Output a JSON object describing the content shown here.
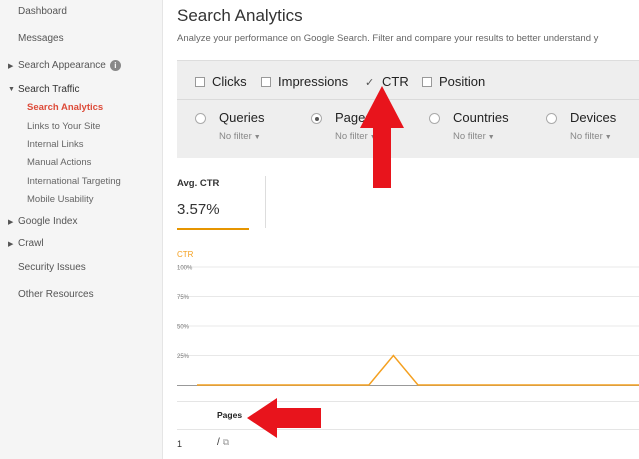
{
  "sidebar": {
    "items": [
      {
        "label": "Dashboard"
      },
      {
        "label": "Messages"
      },
      {
        "label": "Search Appearance"
      },
      {
        "label": "Search Traffic"
      },
      {
        "label": "Google Index"
      },
      {
        "label": "Crawl"
      },
      {
        "label": "Security Issues"
      },
      {
        "label": "Other Resources"
      }
    ],
    "sub_items": [
      {
        "label": "Search Analytics"
      },
      {
        "label": "Links to Your Site"
      },
      {
        "label": "Internal Links"
      },
      {
        "label": "Manual Actions"
      },
      {
        "label": "International Targeting"
      },
      {
        "label": "Mobile Usability"
      }
    ],
    "info_glyph": "i"
  },
  "main": {
    "title": "Search Analytics",
    "subtitle": "Analyze your performance on Google Search. Filter and compare your results to better understand y"
  },
  "metrics": [
    {
      "label": "Clicks",
      "checked": false
    },
    {
      "label": "Impressions",
      "checked": false
    },
    {
      "label": "CTR",
      "checked": true
    },
    {
      "label": "Position",
      "checked": false
    }
  ],
  "dimensions": [
    {
      "label": "Queries",
      "filter": "No filter",
      "selected": false
    },
    {
      "label": "Pages",
      "filter": "No filter",
      "selected": true
    },
    {
      "label": "Countries",
      "filter": "No filter",
      "selected": false
    },
    {
      "label": "Devices",
      "filter": "No filter",
      "selected": false
    }
  ],
  "stat": {
    "label": "Avg. CTR",
    "value": "3.57%"
  },
  "chart_data": {
    "type": "line",
    "ylabel": "CTR",
    "ytick_labels": [
      "100%",
      "75%",
      "50%",
      "25%"
    ],
    "yticks": [
      100,
      75,
      50,
      25
    ],
    "ylim": [
      0,
      100
    ],
    "series": [
      {
        "values": [
          0,
          0,
          0,
          0,
          0,
          0,
          0,
          0,
          25,
          0,
          0,
          0,
          0,
          0,
          0,
          0,
          0,
          0,
          0
        ]
      }
    ],
    "color": "#f4a020"
  },
  "table": {
    "header_pages": "Pages",
    "rows": [
      {
        "num": "1",
        "page": "/"
      }
    ]
  },
  "colors": {
    "accent": "#dd4b39",
    "line": "#f4a020",
    "arrow": "#e8141c"
  }
}
